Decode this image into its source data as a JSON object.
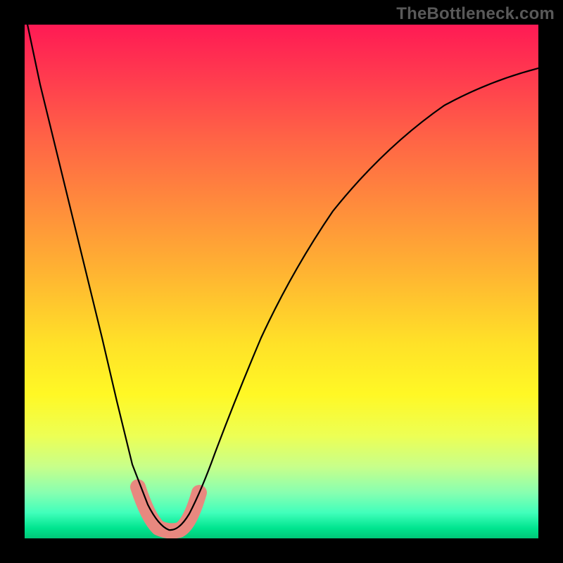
{
  "watermark": "TheBottleneck.com",
  "chart_data": {
    "type": "line",
    "title": "",
    "xlabel": "",
    "ylabel": "",
    "series": [
      {
        "name": "bottleneck-curve",
        "x": [
          0.0,
          0.03,
          0.06,
          0.09,
          0.12,
          0.15,
          0.18,
          0.21,
          0.24,
          0.26,
          0.28,
          0.3,
          0.32,
          0.34,
          0.37,
          0.41,
          0.46,
          0.52,
          0.6,
          0.7,
          0.82,
          1.0
        ],
        "y": [
          1.0,
          0.88,
          0.76,
          0.64,
          0.52,
          0.4,
          0.28,
          0.16,
          0.07,
          0.03,
          0.02,
          0.02,
          0.03,
          0.06,
          0.12,
          0.22,
          0.34,
          0.47,
          0.59,
          0.7,
          0.79,
          0.85
        ]
      }
    ],
    "highlight_band": {
      "name": "optimal-range",
      "x": [
        0.22,
        0.24,
        0.26,
        0.28,
        0.3,
        0.32,
        0.34
      ],
      "y": [
        0.1,
        0.05,
        0.02,
        0.02,
        0.02,
        0.04,
        0.09
      ],
      "color": "#e8887f",
      "stroke_width": 22
    },
    "xlim": [
      0,
      1
    ],
    "ylim": [
      0,
      1
    ],
    "background": "gradient-red-to-green-vertical"
  },
  "colors": {
    "curve": "#000000",
    "highlight": "#e8887f",
    "frame": "#000000"
  }
}
